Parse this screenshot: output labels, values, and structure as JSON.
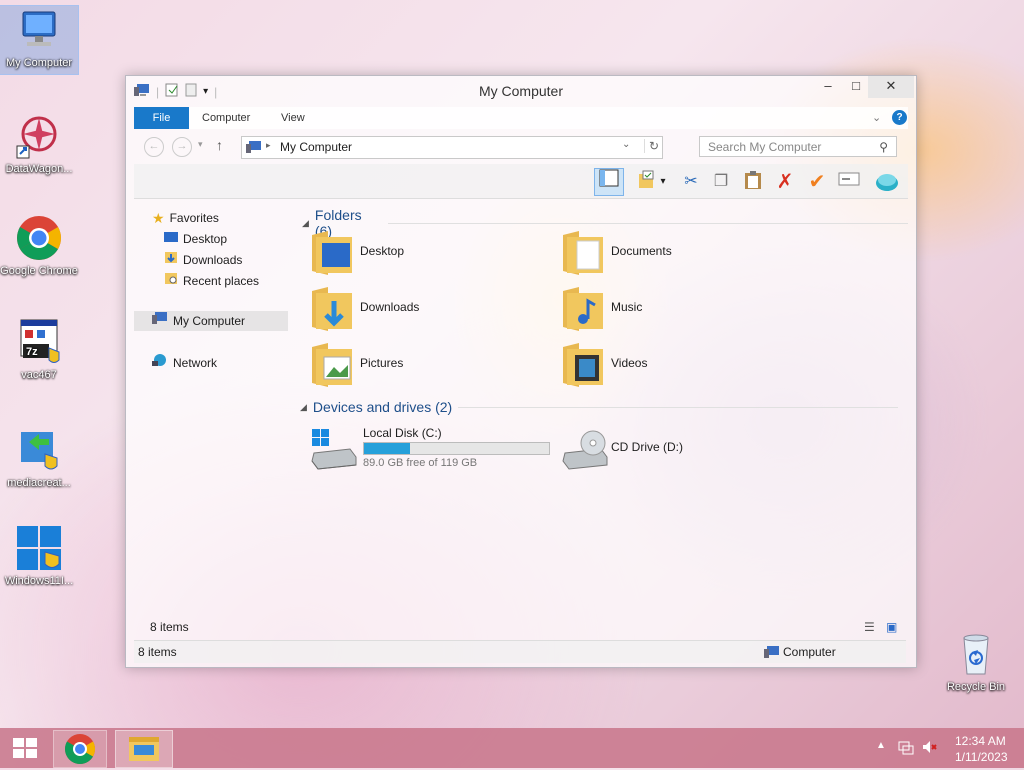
{
  "desktop": {
    "icons": [
      {
        "label": "My Computer",
        "icon": "computer-icon"
      },
      {
        "label": "DataWagon...",
        "icon": "datawagon-icon"
      },
      {
        "label": "Google Chrome",
        "icon": "chrome-icon"
      },
      {
        "label": "vac467",
        "icon": "7zip-installer-icon"
      },
      {
        "label": "mediacreat...",
        "icon": "media-creation-tool-icon"
      },
      {
        "label": "Windows11I...",
        "icon": "windows11-installer-icon"
      },
      {
        "label": "Recycle Bin",
        "icon": "recycle-bin-icon"
      }
    ]
  },
  "window": {
    "title": "My Computer",
    "tabs": [
      "File",
      "Computer",
      "View"
    ],
    "address": "My Computer",
    "search_placeholder": "Search My Computer",
    "nav": {
      "favorites": "Favorites",
      "favorites_items": [
        "Desktop",
        "Downloads",
        "Recent places"
      ],
      "computer": "My Computer",
      "network": "Network"
    },
    "folders_header": "Folders (6)",
    "folders": [
      "Desktop",
      "Documents",
      "Downloads",
      "Music",
      "Pictures",
      "Videos"
    ],
    "drives_header": "Devices and drives (2)",
    "drives": [
      {
        "name": "Local Disk (C:)",
        "free": "89.0 GB free of 119 GB",
        "used_fraction": 0.25
      },
      {
        "name": "CD Drive (D:)"
      }
    ],
    "items_count_top": "8 items",
    "status_left": "8 items",
    "status_right": "Computer"
  },
  "taskbar": {
    "time": "12:34 AM",
    "date": "1/11/2023"
  },
  "colors": {
    "accent": "#1979ca",
    "folder": "#f1c75e",
    "drive_bar": "#26a0da",
    "taskbar": "#c8788c"
  }
}
